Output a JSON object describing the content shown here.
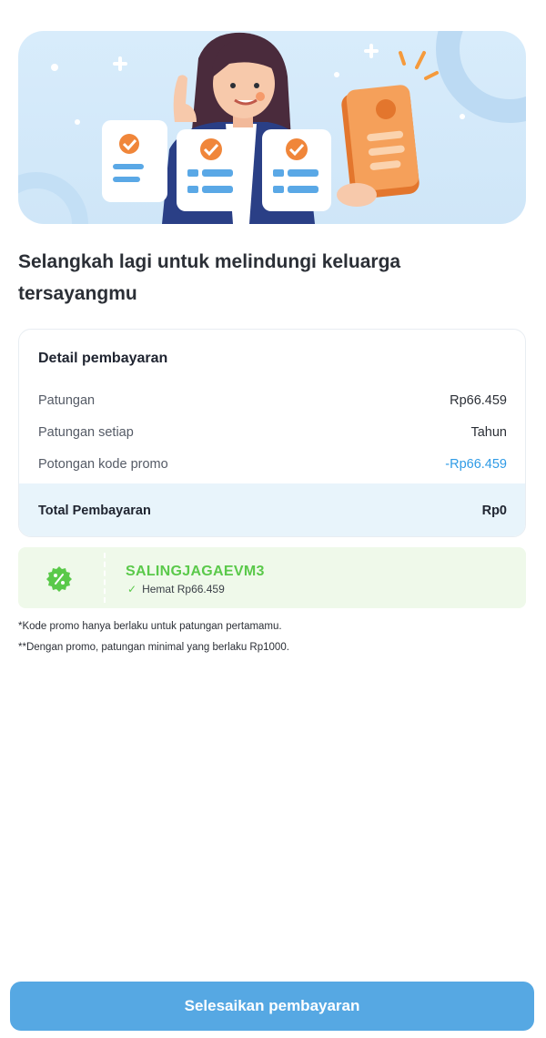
{
  "hero": {
    "illustration": "woman-with-checklists-and-phone"
  },
  "headline": "Selangkah lagi untuk melindungi keluarga tersayangmu",
  "payment": {
    "title": "Detail pembayaran",
    "rows": [
      {
        "label": "Patungan",
        "value": "Rp66.459"
      },
      {
        "label": "Patungan setiap",
        "value": "Tahun"
      },
      {
        "label": "Potongan kode promo",
        "value": "-Rp66.459"
      }
    ],
    "total_label": "Total Pembayaran",
    "total_value": "Rp0"
  },
  "promo": {
    "icon": "percent-badge-icon",
    "code": "SALINGJAGAEVM3",
    "savings": "Hemat Rp66.459"
  },
  "notes": [
    "*Kode promo hanya berlaku untuk patungan pertamamu.",
    "**Dengan promo, patungan minimal yang berlaku Rp1000."
  ],
  "cta": {
    "label": "Selesaikan pembayaran"
  },
  "colors": {
    "primary": "#56a8e3",
    "promo_text": "#2f9be6",
    "coupon_bg": "#eff9ea",
    "coupon_accent": "#5ac94a",
    "total_bg": "#e8f4fb"
  }
}
